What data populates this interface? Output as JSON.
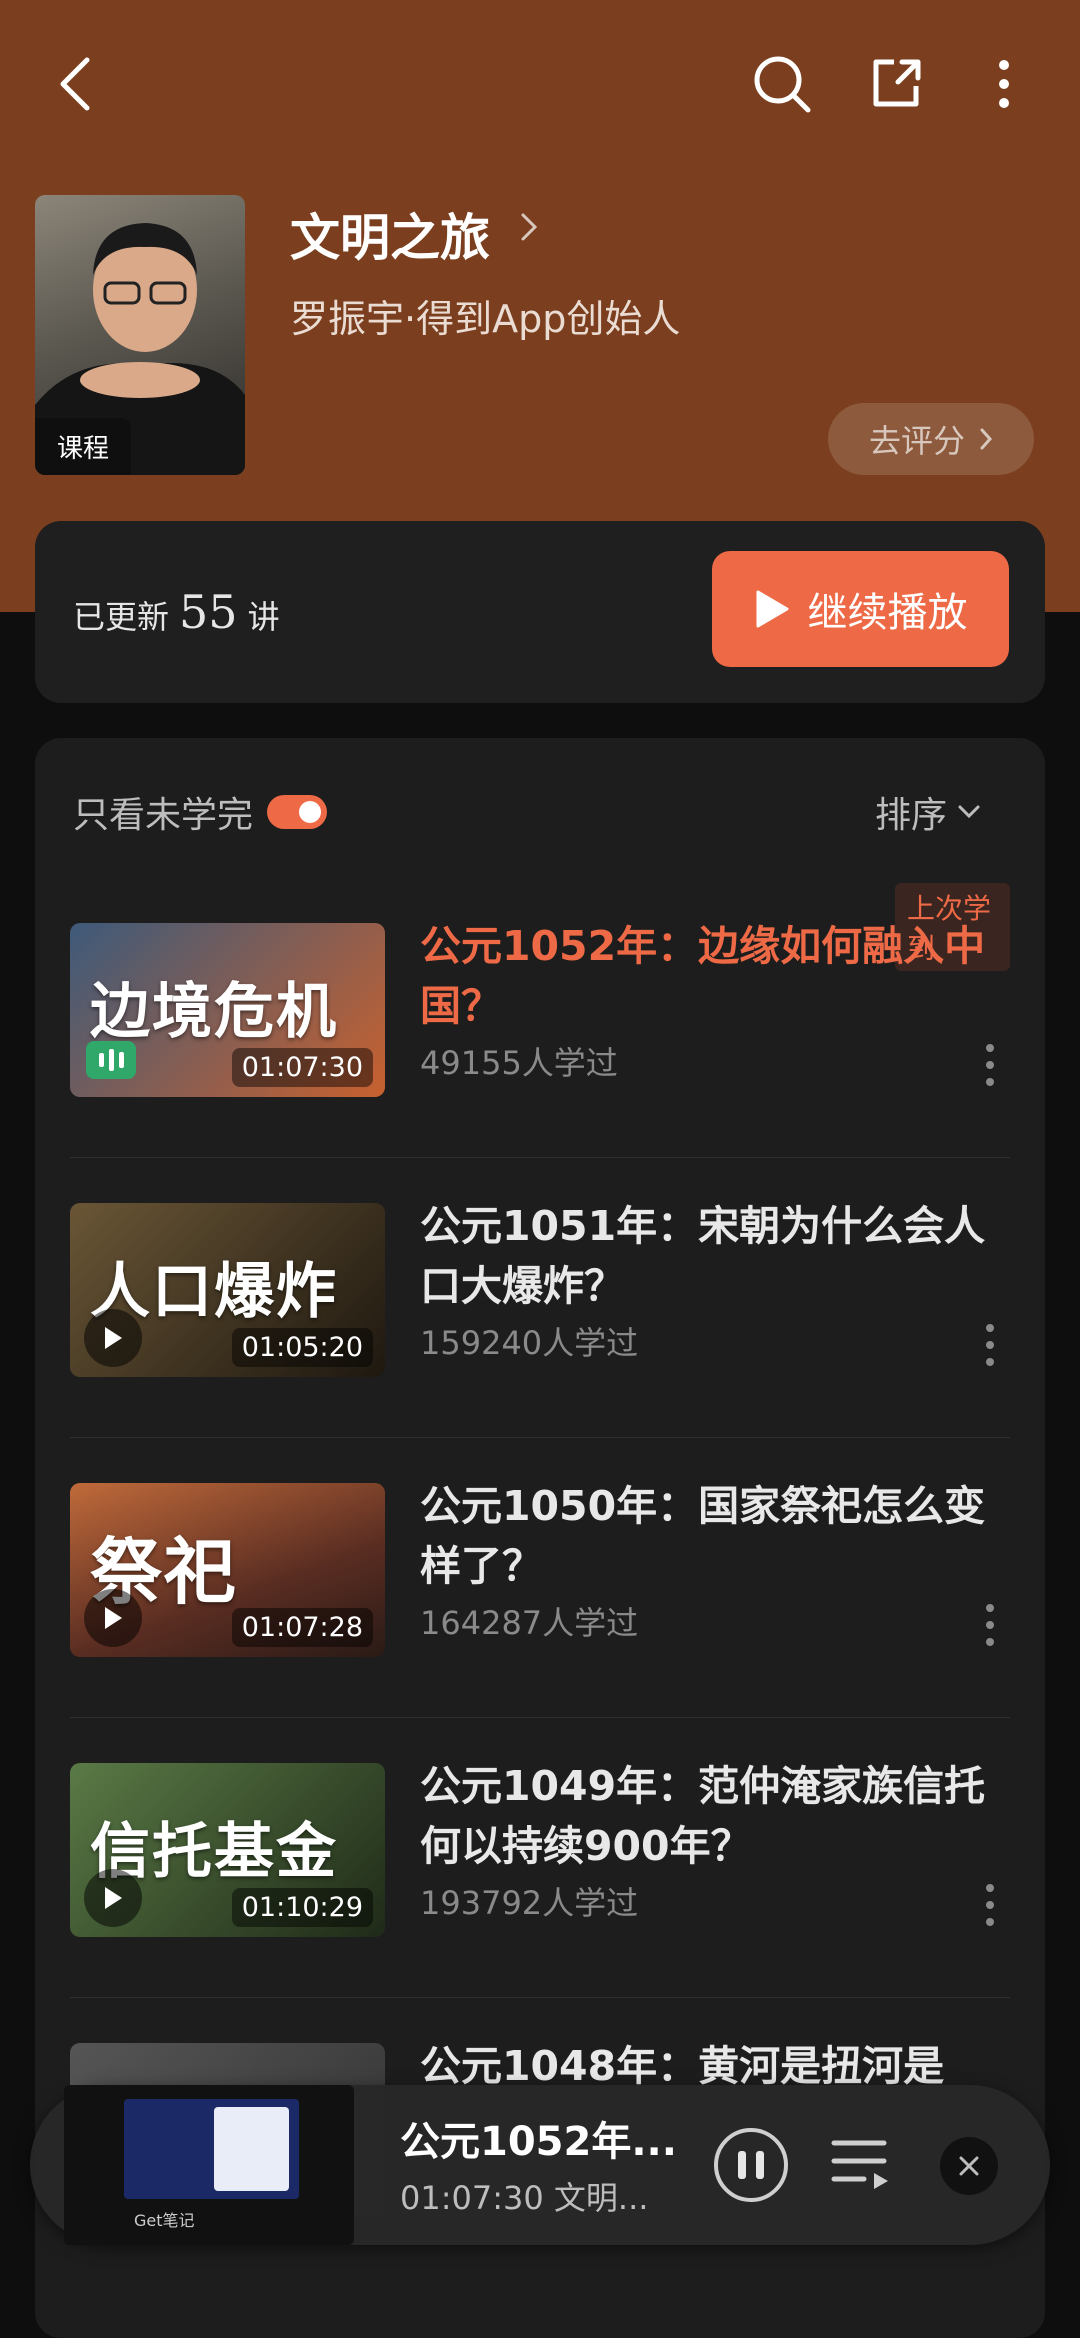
{
  "header": {
    "course_title": "文明之旅",
    "author": "罗振宇·得到App创始人",
    "cover_tag": "课程",
    "rate_label": "去评分"
  },
  "update": {
    "prefix": "已更新",
    "count": "55",
    "suffix": "讲",
    "continue_label": "继续播放"
  },
  "list_controls": {
    "filter_label": "只看未学完",
    "filter_on": true,
    "sort_label": "排序"
  },
  "episodes": [
    {
      "thumb_text": "边境危机",
      "duration": "01:07:30",
      "title": "公元1052年：边缘如何融入中国？",
      "learners": "49155人学过",
      "last_tag": "上次学到",
      "playing": true,
      "colors": [
        "#3d5a7a",
        "#c8612f"
      ]
    },
    {
      "thumb_text": "人口爆炸",
      "duration": "01:05:20",
      "title": "公元1051年：宋朝为什么会人口大爆炸？",
      "learners": "159240人学过",
      "colors": [
        "#5a4a2f",
        "#2a2218"
      ]
    },
    {
      "thumb_text": "祭祀",
      "duration": "01:07:28",
      "title": "公元1050年：国家祭祀怎么变样了？",
      "learners": "164287人学过",
      "colors": [
        "#b05a2a",
        "#3a2520"
      ]
    },
    {
      "thumb_text": "信托基金",
      "duration": "01:10:29",
      "title": "公元1049年：范仲淹家族信托何以持续900年？",
      "learners": "193792人学过",
      "colors": [
        "#4a6a3a",
        "#26331f"
      ]
    },
    {
      "thumb_text": "",
      "duration": "",
      "title": "公元1048年：黄河是扭河是",
      "learners": "",
      "colors": [
        "#555",
        "#333"
      ]
    }
  ],
  "player": {
    "title": "公元1052年...",
    "subtitle": "01:07:30  文明...",
    "thumb_caption": "Get笔记"
  }
}
